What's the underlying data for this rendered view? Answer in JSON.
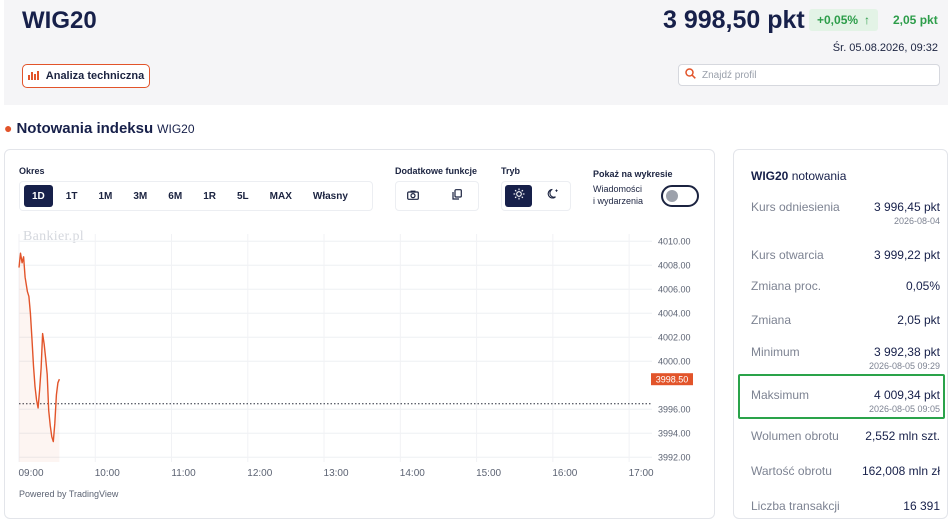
{
  "header": {
    "title": "WIG20",
    "price": "3 998,50 pkt",
    "change_pct": "+0,05%",
    "change_arrow": "↑",
    "change_abs": "2,05 pkt",
    "datetime": "Śr. 05.08.2026, 09:32",
    "analysis_button": "Analiza techniczna",
    "search_placeholder": "Znajdź profil",
    "colors": {
      "accent": "#e2542a",
      "navy": "#17204a",
      "positive": "#2d9d4a"
    }
  },
  "section": {
    "title": "Notowania indeksu",
    "subtitle": "WIG20"
  },
  "chart_panel": {
    "okres_label": "Okres",
    "periods": [
      "1D",
      "1T",
      "1M",
      "3M",
      "6M",
      "1R",
      "5L",
      "MAX",
      "Własny"
    ],
    "active_period": "1D",
    "dodatkowe_label": "Dodatkowe funkcje",
    "tryb_label": "Tryb",
    "pokaz_label": "Pokaż na wykresie",
    "wiadomosci_line1": "Wiadomości",
    "wiadomosci_line2": "i wydarzenia",
    "watermark": "Bankier.pl",
    "powered": "Powered by TradingView",
    "last_price_label": "3998.50"
  },
  "chart_data": {
    "type": "line",
    "x_ticks": [
      "09:00",
      "10:00",
      "11:00",
      "12:00",
      "13:00",
      "14:00",
      "15:00",
      "16:00",
      "17:00"
    ],
    "y_ticks": [
      "4010.00",
      "4008.00",
      "4006.00",
      "4004.00",
      "4002.00",
      "4000.00",
      "3998.50",
      "3996.00",
      "3994.00",
      "3992.00"
    ],
    "ylim": [
      3991.6,
      4010.6
    ],
    "xlim": [
      0,
      8.3
    ],
    "reference_line": 3996.45,
    "last_value": 3998.5,
    "grid": true,
    "series": [
      {
        "x": [
          0,
          0.02,
          0.04,
          0.06,
          0.08,
          0.11,
          0.13,
          0.15,
          0.17,
          0.19,
          0.21,
          0.23,
          0.25,
          0.27,
          0.29,
          0.31,
          0.33,
          0.35,
          0.37,
          0.39,
          0.41,
          0.43,
          0.45,
          0.47,
          0.49,
          0.51,
          0.53
        ],
        "y": [
          4007.8,
          4009.0,
          4008.2,
          4008.7,
          4007.0,
          4005.8,
          4005.4,
          4004.0,
          4001.8,
          3999.6,
          3997.9,
          3996.8,
          3996.1,
          3997.6,
          3999.4,
          4002.3,
          4001.4,
          4000.2,
          3998.9,
          3995.9,
          3994.6,
          3993.7,
          3993.3,
          3994.8,
          3997.2,
          3998.2,
          3998.5
        ]
      }
    ]
  },
  "quotes": {
    "title_bold": "WIG20",
    "title_rest": "notowania",
    "rows": [
      {
        "label": "Kurs odniesienia",
        "value": "3 996,45 pkt",
        "date": "2026-08-04"
      },
      {
        "label": "Kurs otwarcia",
        "value": "3 999,22 pkt",
        "date": ""
      },
      {
        "label": "Zmiana proc.",
        "value": "0,05%",
        "date": ""
      },
      {
        "label": "Zmiana",
        "value": "2,05 pkt",
        "date": ""
      },
      {
        "label": "Minimum",
        "value": "3 992,38 pkt",
        "date": "2026-08-05 09:29"
      },
      {
        "label": "Maksimum",
        "value": "4 009,34 pkt",
        "date": "2026-08-05 09:05"
      },
      {
        "label": "Wolumen obrotu",
        "value": "2,552 mln szt.",
        "date": ""
      },
      {
        "label": "Wartość obrotu",
        "value": "162,008 mln zł",
        "date": ""
      },
      {
        "label": "Liczba transakcji",
        "value": "16 391",
        "date": ""
      }
    ]
  }
}
